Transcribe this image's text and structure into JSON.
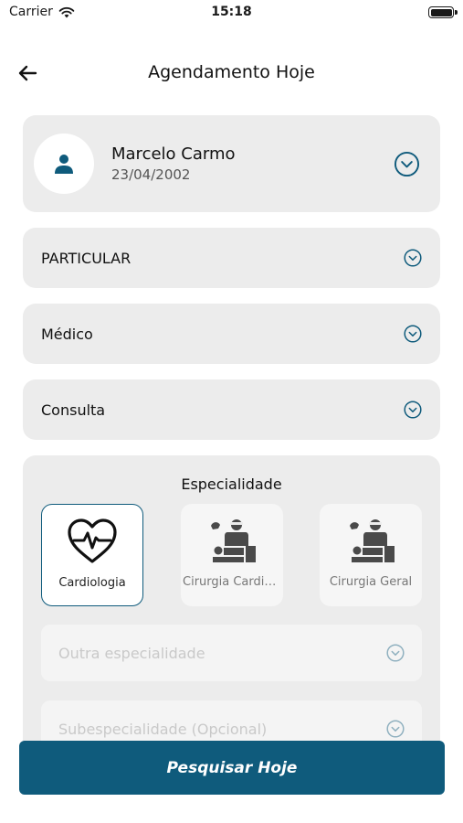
{
  "status_bar": {
    "carrier": "Carrier",
    "time": "15:18",
    "wifi_icon": "wifi-icon",
    "battery_icon": "battery-icon"
  },
  "header": {
    "title": "Agendamento Hoje",
    "back_icon": "arrow-left-icon"
  },
  "patient": {
    "name": "Marcelo Carmo",
    "birth_date": "23/04/2002",
    "avatar_icon": "person-icon",
    "expand_icon": "chevron-down-circle-icon"
  },
  "selectors": [
    {
      "label": "PARTICULAR"
    },
    {
      "label": "Médico"
    },
    {
      "label": "Consulta"
    }
  ],
  "specialty": {
    "title": "Especialidade",
    "tiles": [
      {
        "label": "Cardiologia",
        "icon": "heart-pulse-icon",
        "selected": true
      },
      {
        "label": "Cirurgia Cardiov...",
        "icon": "surgery-icon",
        "selected": false
      },
      {
        "label": "Cirurgia Geral",
        "icon": "surgery-icon",
        "selected": false
      }
    ],
    "other_placeholder": "Outra especialidade",
    "subspecialty_placeholder": "Subespecialidade (Opcional)"
  },
  "actions": {
    "search_label": "Pesquisar Hoje"
  },
  "colors": {
    "primary": "#0f5b7c",
    "card_bg": "#ececec",
    "placeholder": "#c9c9c9"
  }
}
